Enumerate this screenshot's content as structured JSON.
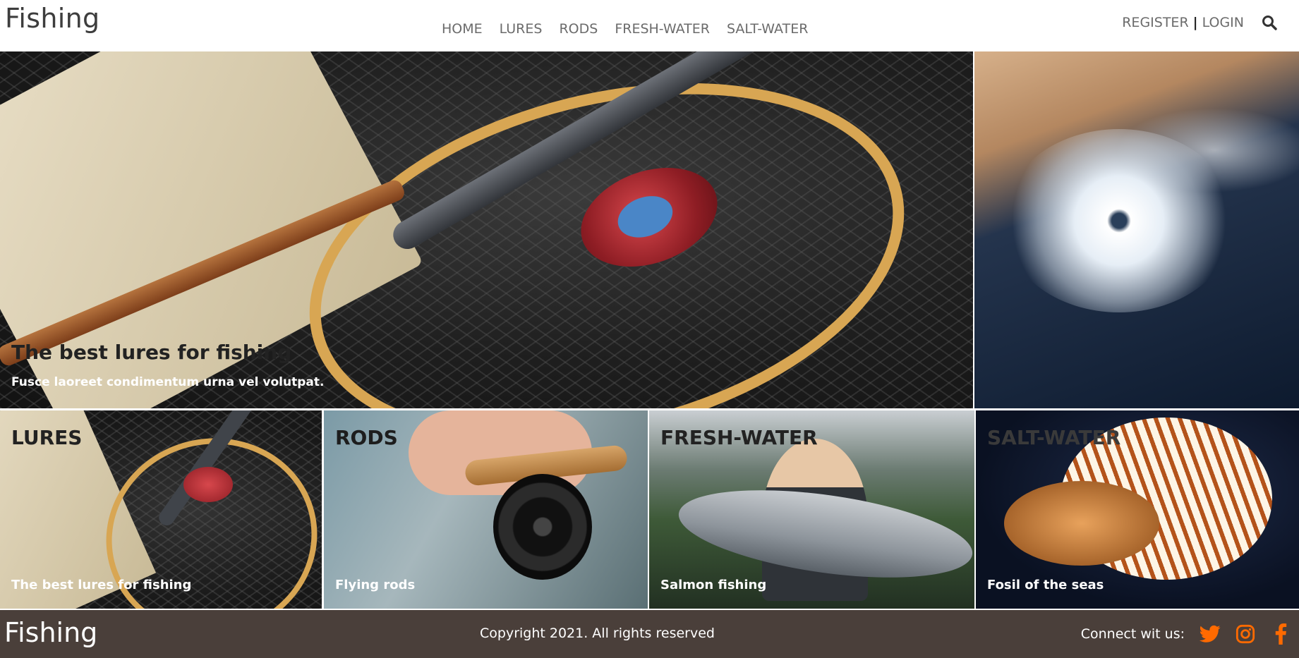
{
  "header": {
    "logo": "Fishing",
    "nav": [
      "HOME",
      "LURES",
      "RODS",
      "FRESH-WATER",
      "SALT-WATER"
    ],
    "register": "REGISTER",
    "separator": "|",
    "login": "LOGIN",
    "search_icon": "search-icon"
  },
  "hero": {
    "title": "The best lures for fishing",
    "subtitle": "Fusce laoreet condimentum urna vel volutpat."
  },
  "cards": [
    {
      "title": "LURES",
      "subtitle": "The best lures for fishing"
    },
    {
      "title": "RODS",
      "subtitle": "Flying rods"
    },
    {
      "title": "FRESH-WATER",
      "subtitle": "Salmon fishing"
    },
    {
      "title": "SALT-WATER",
      "subtitle": "Fosil of the seas"
    }
  ],
  "footer": {
    "logo": "Fishing",
    "copyright": "Copyright 2021. All rights reserved",
    "connect": "Connect wit us:",
    "social_icons": [
      "twitter-icon",
      "instagram-icon",
      "facebook-icon"
    ],
    "accent": "#ff6a00",
    "background": "#4a3f3a"
  }
}
